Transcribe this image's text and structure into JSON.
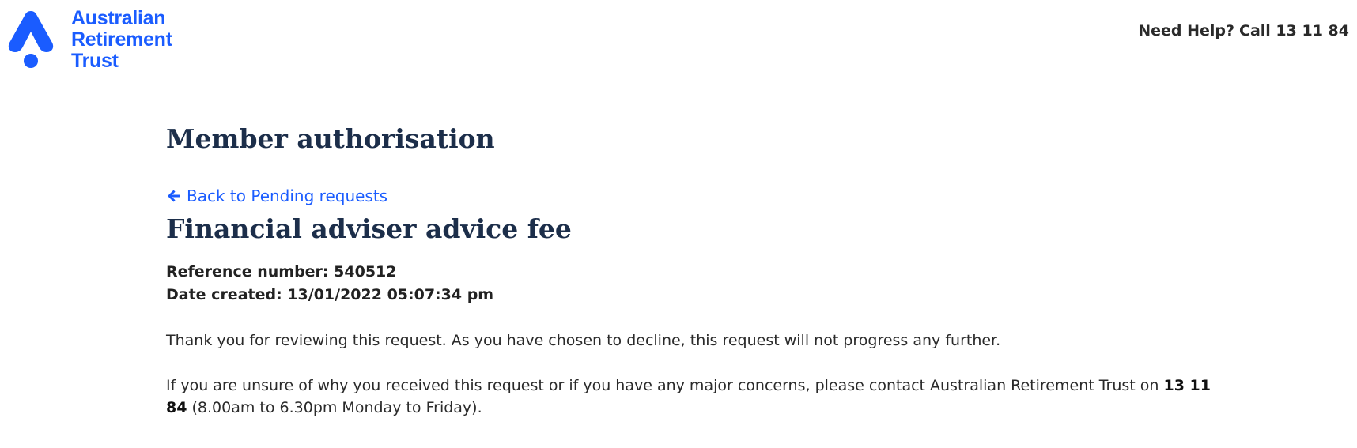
{
  "header": {
    "logo_lines": [
      "Australian",
      "Retirement",
      "Trust"
    ],
    "help_label": "Need Help?",
    "help_call": "Call 13 11 84"
  },
  "main": {
    "page_title": "Member authorisation",
    "back_link_label": "Back to Pending requests",
    "request_title": "Financial adviser advice fee",
    "reference_label": "Reference number:",
    "reference_value": "540512",
    "date_label": "Date created:",
    "date_value": "13/01/2022 05:07:34 pm",
    "paragraph_1": "Thank you for reviewing this request. As you have chosen to decline, this request will not progress any further.",
    "paragraph_2_prefix": "If you are unsure of why you received this request or if you have any major concerns, please contact Australian Retirement Trust on",
    "paragraph_2_phone": "13 11 84",
    "paragraph_2_suffix": "(8.00am to 6.30pm Monday to Friday)."
  },
  "colors": {
    "brand_blue": "#1a5cff",
    "heading_navy": "#1c2e4a",
    "text": "#2a2a2a"
  },
  "icons": {
    "back_link": "arrow-left-icon",
    "logo": "art-logo-mark"
  }
}
